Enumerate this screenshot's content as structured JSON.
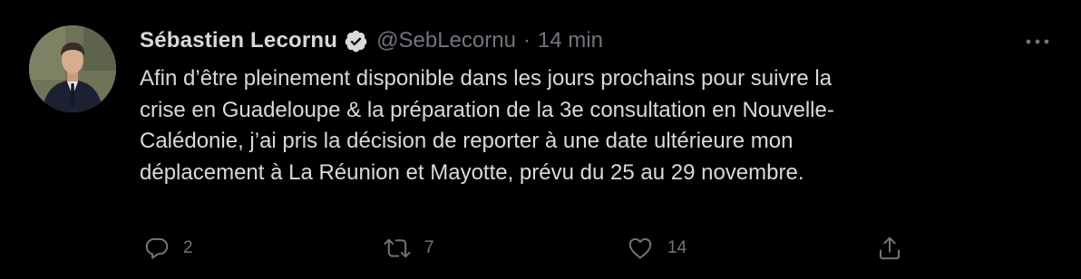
{
  "author": {
    "display_name": "Sébastien Lecornu",
    "handle": "@SebLecornu",
    "separator": "·",
    "time": "14 min",
    "verified": true
  },
  "tweet": {
    "lines": [
      "Afin d’être pleinement disponible dans les jours prochains pour suivre la",
      "crise en Guadeloupe & la préparation de la 3e consultation en Nouvelle-",
      "Calédonie, j’ai pris la décision de reporter à une date ultérieure mon",
      "déplacement à La Réunion et Mayotte, prévu du 25 au 29 novembre."
    ]
  },
  "actions": {
    "reply_count": "2",
    "retweet_count": "7",
    "like_count": "14"
  },
  "icons": {
    "verified": "verified-badge-icon",
    "more": "more-options-icon",
    "reply": "reply-icon",
    "retweet": "retweet-icon",
    "like": "heart-icon",
    "share": "share-icon"
  },
  "colors": {
    "background": "#000000",
    "primary_text": "#d9d9d9",
    "secondary_text": "#6e767d"
  }
}
